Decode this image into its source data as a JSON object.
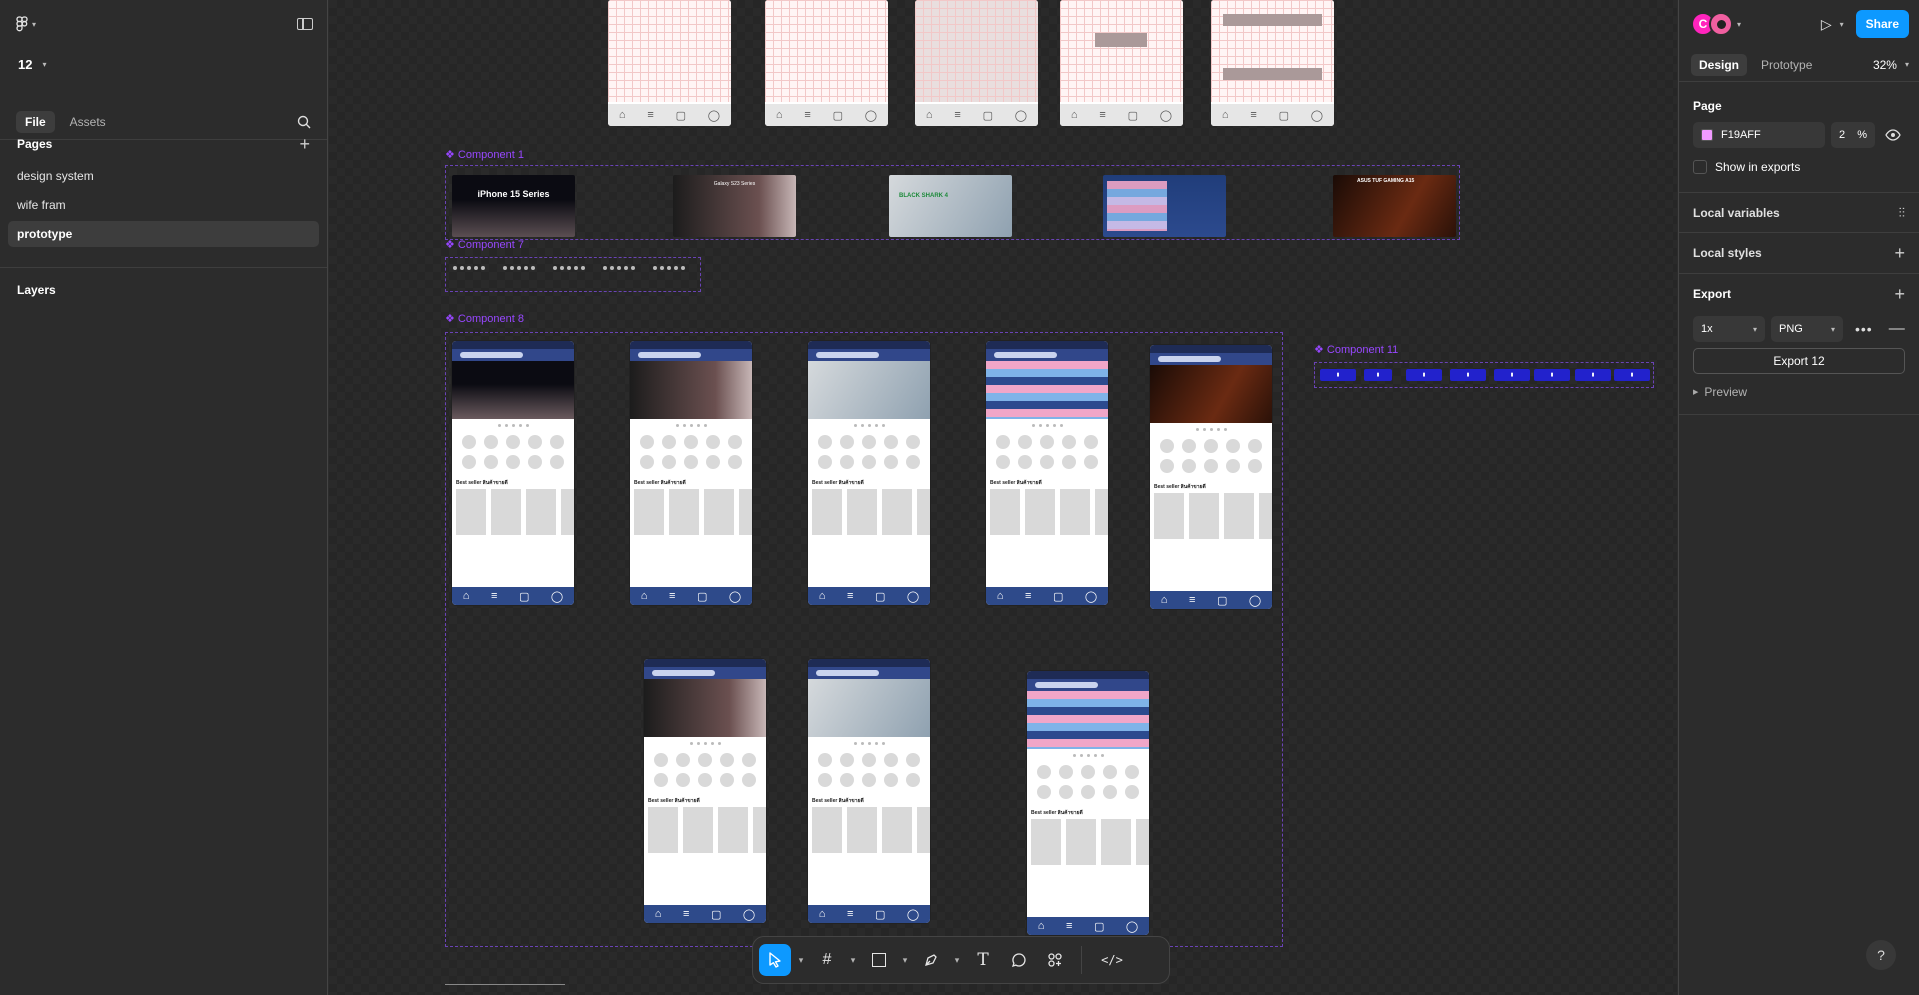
{
  "header": {
    "zoom_page": "12"
  },
  "left_panel": {
    "tabs": [
      "File",
      "Assets"
    ],
    "pages_title": "Pages",
    "pages": [
      "design system",
      "wife fram",
      "prototype"
    ],
    "active_page": "prototype",
    "layers_title": "Layers"
  },
  "right_panel": {
    "avatar_initial": "C",
    "share_label": "Share",
    "mode_tabs": [
      "Design",
      "Prototype"
    ],
    "zoom": "32%",
    "page_section": "Page",
    "page_color_hex": "F19AFF",
    "page_opacity": "2",
    "page_opacity_unit": "%",
    "show_in_exports": "Show in exports",
    "local_variables": "Local variables",
    "local_styles": "Local styles",
    "export_title": "Export",
    "export_scale": "1x",
    "export_format": "PNG",
    "export_button": "Export 12",
    "preview_label": "Preview",
    "colors": {
      "page_swatch": "#F19AFF",
      "accent": "#0D99FF"
    }
  },
  "canvas": {
    "component_labels": [
      "Component 1",
      "Component 7",
      "Component 8",
      "Component 11"
    ],
    "banner_texts": [
      "iPhone 15 Series",
      "Galaxy S23 Series",
      "BLACK SHARK 4",
      "ASUS TUF GAMING A15"
    ],
    "best_seller": "Best seller สินค้าขายดี",
    "colors": {
      "component": "#9747FF",
      "phone_nav": "#2E4A8A"
    }
  },
  "toolbar": {
    "tools": [
      "move-tool",
      "frame-tool",
      "shape-tool",
      "pen-tool",
      "text-tool",
      "comment-tool",
      "actions-tool",
      "dev-mode-tool"
    ]
  },
  "help": "?"
}
